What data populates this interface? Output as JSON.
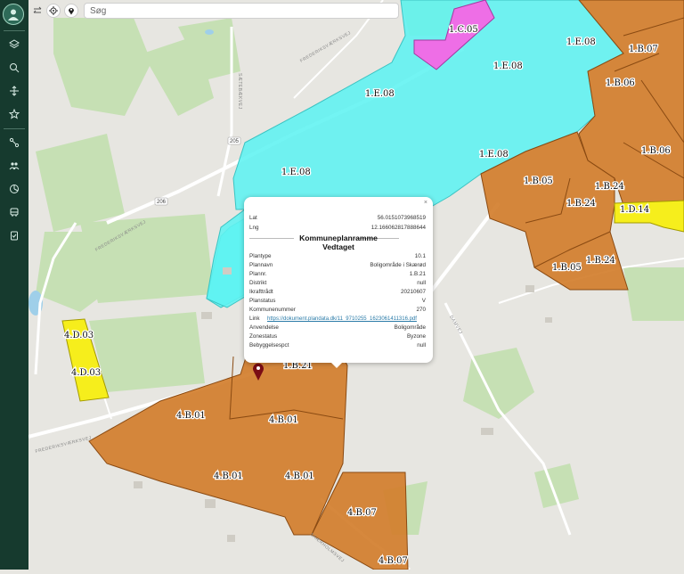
{
  "search": {
    "placeholder": "Søg"
  },
  "zones": {
    "c05": "1.C.05",
    "e08": "1.E.08",
    "b06": "1.B.06",
    "b07": "1.B.07",
    "b05": "1.B.05",
    "b24": "1.B.24",
    "b21": "1.B.21",
    "d14": "1.D.14",
    "d03": "4.D.03",
    "ib01": "4.B.01",
    "ib07": "4.B.07"
  },
  "roads": {
    "frederiksvaerksvej": "FREDERIKSVÆRKSVEJ",
    "route_205": "205",
    "route_206": "206",
    "saltbaek": "SÆTEBÆKVEJ",
    "skarholm": "SKÆRHOLMSVEJ",
    "damvej": "DAMVEJ"
  },
  "popup": {
    "lat_label": "Lat",
    "lat": "56.0151073968519",
    "lng_label": "Lng",
    "lng": "12.166062817888644",
    "title_1": "Kommuneplanramme",
    "title_2": "Vedtaget",
    "rows": [
      {
        "k": "Plantype",
        "v": "10.1"
      },
      {
        "k": "Plannavn",
        "v": "Boligområde i Skærød"
      },
      {
        "k": "Plannr.",
        "v": "1.B.21"
      },
      {
        "k": "Distrikt",
        "v": "null"
      },
      {
        "k": "Ikrafttrådt",
        "v": "20210607"
      },
      {
        "k": "Planstatus",
        "v": "V"
      },
      {
        "k": "Kommunenummer",
        "v": "270"
      },
      {
        "k": "Link",
        "v": "https://dokument.plandata.dk/11_9710255_1623061411316.pdf"
      },
      {
        "k": "Anvendelse",
        "v": "Boligområde"
      },
      {
        "k": "Zonestatus",
        "v": "Byzone"
      },
      {
        "k": "Bebyggelsespct",
        "v": "null"
      }
    ],
    "close": "×"
  },
  "colors": {
    "sidebar": "#163a2e",
    "cyan_zone": "#5ef2f1",
    "orange_zone": "#d27e2c",
    "pink_zone": "#ee6ee6",
    "yellow_zone": "#f6ee1c",
    "marker": "#7a0d15"
  }
}
